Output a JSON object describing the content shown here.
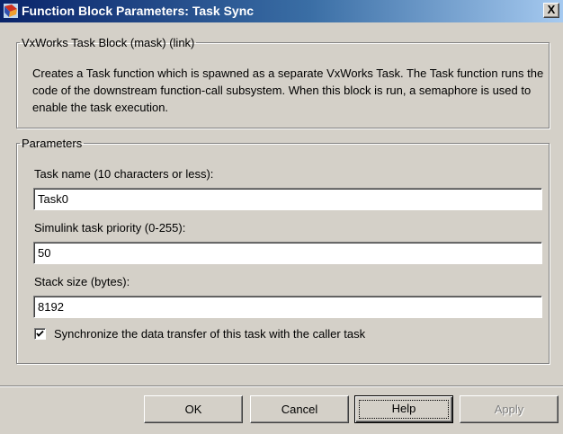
{
  "window": {
    "title": "Function Block Parameters: Task Sync",
    "close_label": "X"
  },
  "mask_group": {
    "legend": "VxWorks Task Block (mask) (link)",
    "description": "Creates a Task function which is spawned as a separate VxWorks Task. The Task function runs the code of the downstream function-call subsystem. When this block is run, a semaphore is used to enable the task execution."
  },
  "parameters_group": {
    "legend": "Parameters",
    "task_name": {
      "label": "Task name (10 characters or less):",
      "value": "Task0"
    },
    "priority": {
      "label": "Simulink task priority (0-255):",
      "value": "50"
    },
    "stack_size": {
      "label": "Stack size (bytes):",
      "value": "8192"
    },
    "synchronize": {
      "label": "Synchronize the data transfer of this task with the caller task",
      "checked": true
    }
  },
  "buttons": {
    "ok": "OK",
    "cancel": "Cancel",
    "help": "Help",
    "apply": "Apply"
  }
}
